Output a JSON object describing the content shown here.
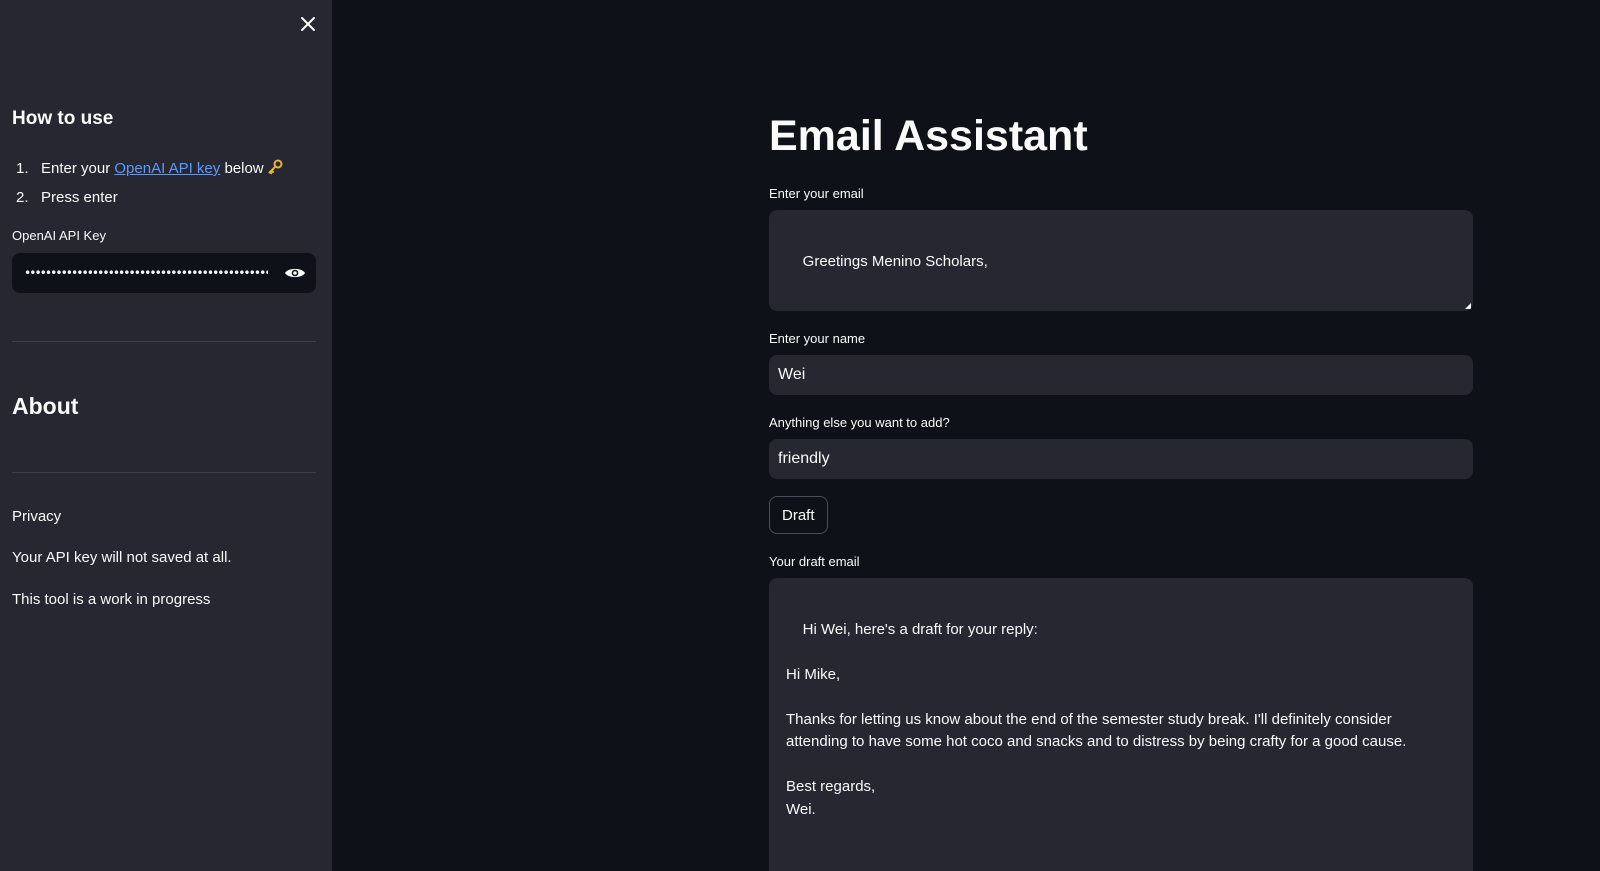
{
  "sidebar": {
    "close_icon": "close-icon",
    "howto_title": "How to use",
    "steps": [
      {
        "num": "1.",
        "text_before": "Enter your ",
        "link": "OpenAI API key",
        "text_after": " below",
        "icon": "key-icon"
      },
      {
        "num": "2.",
        "text": "Press enter"
      }
    ],
    "api_key_label": "OpenAI API Key",
    "api_key_value": "sk-hidden-api-key-value-placeholder-xxxxxxxxxxxxxxxxxxxx",
    "eye_icon": "eye-icon",
    "about_title": "About",
    "privacy_title": "Privacy",
    "privacy_text": "Your API key will not saved at all.",
    "wip_text": "This tool is a work in progress"
  },
  "main": {
    "title": "Email Assistant",
    "email_label": "Enter your email",
    "email_value": "Greetings Menino Scholars,",
    "name_label": "Enter your name",
    "name_value": "Wei",
    "extra_label": "Anything else you want to add?",
    "extra_value": "friendly",
    "draft_button": "Draft",
    "draft_label": "Your draft email",
    "draft_value": "Hi Wei, here's a draft for your reply:\n\nHi Mike,\n\nThanks for letting us know about the end of the semester study break. I'll definitely consider attending to have some hot coco and snacks and to distress by being crafty for a good cause.\n\nBest regards,\nWei."
  },
  "colors": {
    "background": "#0e1117",
    "sidebar": "#262730",
    "input": "#262730",
    "link": "#5a9bff",
    "text": "#fafafa"
  }
}
